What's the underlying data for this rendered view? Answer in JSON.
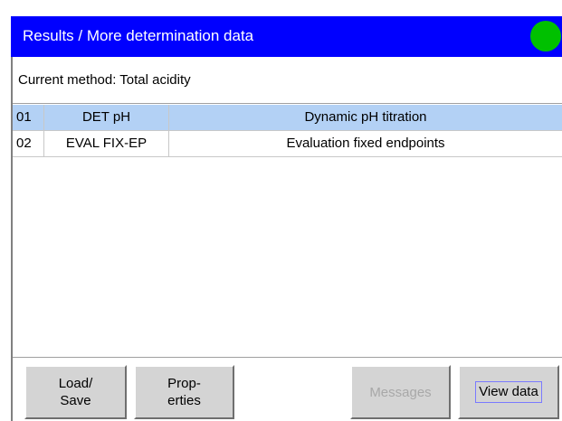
{
  "header": {
    "title": "Results / More determination data",
    "status_color": "#00c000",
    "title_bar_color": "#0000ff"
  },
  "method": {
    "text": "Current method: Total acidity"
  },
  "table": {
    "rows": [
      {
        "number": "01",
        "command": "DET pH",
        "description": "Dynamic pH titration",
        "selected": true
      },
      {
        "number": "02",
        "command": "EVAL FIX-EP",
        "description": "Evaluation fixed endpoints",
        "selected": false
      }
    ],
    "selected_color": "#b3d1f5"
  },
  "buttons": {
    "load_save": {
      "line1": "Load/",
      "line2": "Save"
    },
    "properties": {
      "line1": "Prop-",
      "line2": "erties"
    },
    "messages": {
      "label": "Messages",
      "enabled": false
    },
    "view_data": {
      "label": "View data"
    }
  }
}
